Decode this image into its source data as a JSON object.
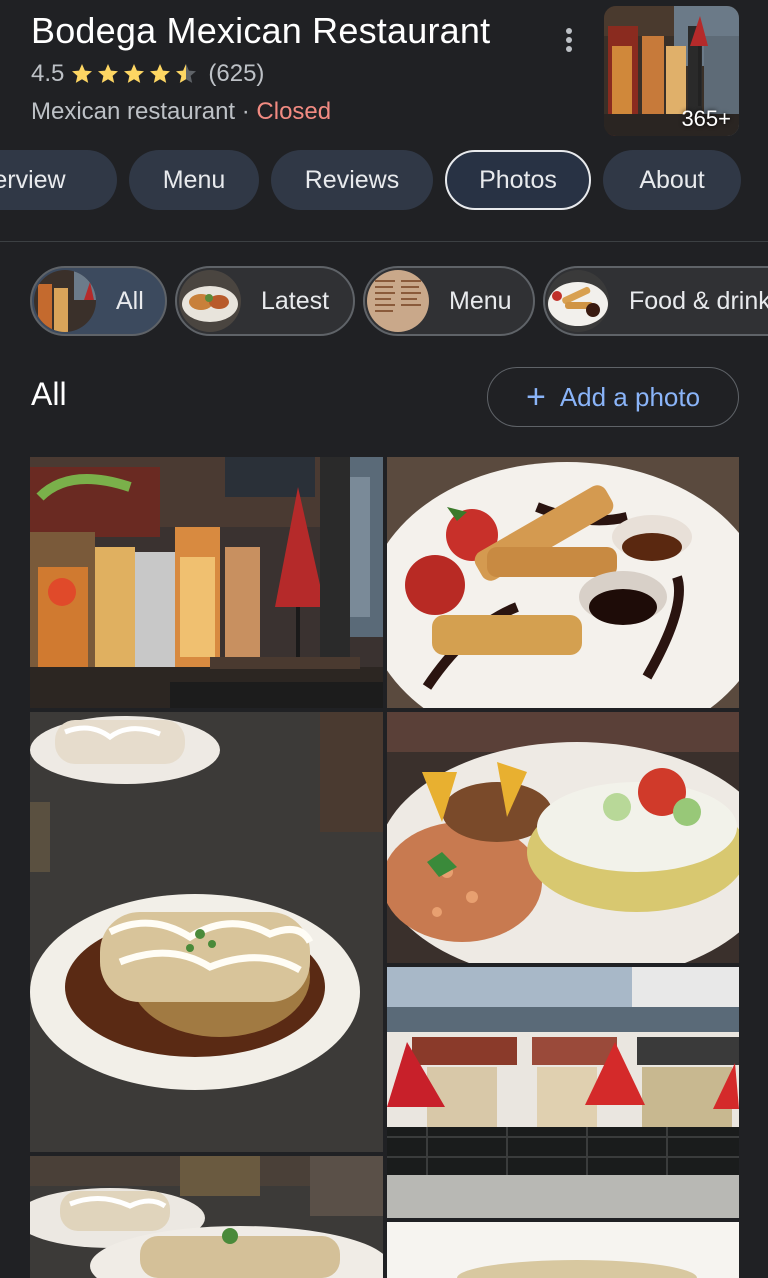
{
  "place": {
    "name": "Bodega Mexican Restaurant",
    "rating": "4.5",
    "review_count": "(625)",
    "category": "Mexican restaurant",
    "separator": " · ",
    "status": "Closed",
    "photo_count": "365+",
    "star_color": "#fdd663"
  },
  "tabs": [
    {
      "label": "Overview"
    },
    {
      "label": "Menu"
    },
    {
      "label": "Reviews"
    },
    {
      "label": "Photos"
    },
    {
      "label": "About"
    }
  ],
  "photo_filters": [
    {
      "label": "All"
    },
    {
      "label": "Latest"
    },
    {
      "label": "Menu"
    },
    {
      "label": "Food & drink"
    }
  ],
  "section": {
    "title": "All",
    "add_photo_label": "Add a photo",
    "add_photo_icon": "plus-icon"
  },
  "photos": [
    {
      "subject": "storefront-evening"
    },
    {
      "subject": "churros-dessert"
    },
    {
      "subject": "burrito-plate"
    },
    {
      "subject": "enchilada-plate"
    },
    {
      "subject": "storefront-patio"
    },
    {
      "subject": "burrito-plates-table"
    },
    {
      "subject": "dish-partial"
    }
  ],
  "colors": {
    "background": "#202124",
    "link_blue": "#8ab4f8",
    "closed_red": "#f28b82"
  }
}
